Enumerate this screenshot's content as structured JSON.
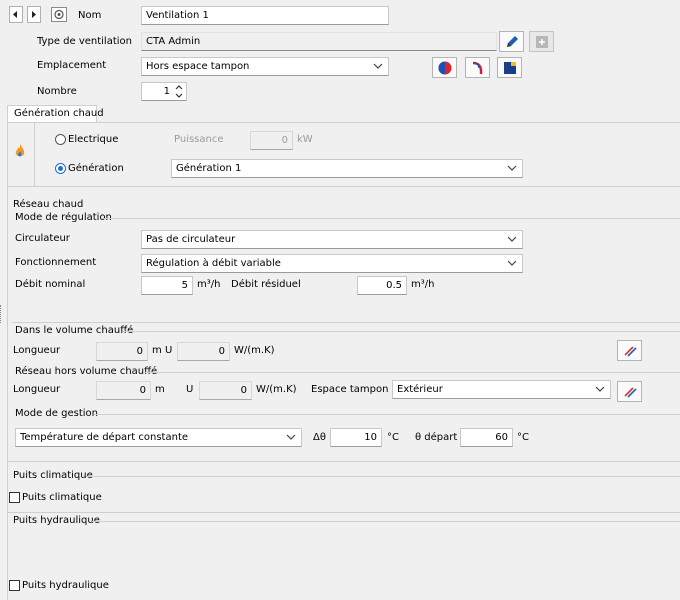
{
  "header": {
    "nom_label": "Nom",
    "nom_value": "Ventilation 1",
    "type_label": "Type de ventilation",
    "type_value": "CTA Admin",
    "emplacement_label": "Emplacement",
    "emplacement_value": "Hors espace tampon",
    "nombre_label": "Nombre",
    "nombre_value": "1"
  },
  "tab": {
    "label": "Génération chaud"
  },
  "generation": {
    "electrique_label": "Electrique",
    "puissance_label": "Puissance",
    "puissance_value": "0",
    "puissance_unit": "kW",
    "generation_label": "Génération",
    "generation_value": "Génération 1",
    "selected": "generation"
  },
  "reseau": {
    "title": "Réseau chaud",
    "mode_title": "Mode de régulation",
    "circulateur_label": "Circulateur",
    "circulateur_value": "Pas de circulateur",
    "fonctionnement_label": "Fonctionnement",
    "fonctionnement_value": "Régulation à débit variable",
    "debit_nominal_label": "Débit nominal",
    "debit_nominal_value": "5",
    "debit_nominal_unit": "m³/h",
    "debit_residuel_label": "Débit résiduel",
    "debit_residuel_value": "0.5",
    "debit_residuel_unit": "m³/h"
  },
  "volume_chauffe": {
    "title": "Dans le volume chauffé",
    "longueur_label": "Longueur",
    "longueur_value": "0",
    "longueur_unit": "m",
    "u_label": "U",
    "u_value": "0",
    "u_unit": "W/(m.K)"
  },
  "hors_volume": {
    "title": "Réseau hors volume chauffé",
    "longueur_label": "Longueur",
    "longueur_value": "0",
    "longueur_unit": "m",
    "u_label": "U",
    "u_value": "0",
    "u_unit": "W/(m.K)",
    "espace_label": "Espace tampon",
    "espace_value": "Extérieur"
  },
  "gestion": {
    "title": "Mode de gestion",
    "mode_value": "Température de départ constante",
    "delta_label": "Δθ",
    "delta_value": "10",
    "delta_unit": "°C",
    "depart_label": "θ départ",
    "depart_value": "60",
    "depart_unit": "°C"
  },
  "puits_climatique": {
    "title": "Puits climatique",
    "checkbox_label": "Puits climatique",
    "checked": false
  },
  "puits_hydraulique": {
    "title": "Puits hydraulique",
    "checkbox_label": "Puits hydraulique",
    "checked": false
  },
  "colors": {
    "accent": "#1e6fd0",
    "window_bg": "#f0f0f0",
    "separator": "#cfcfcf"
  }
}
